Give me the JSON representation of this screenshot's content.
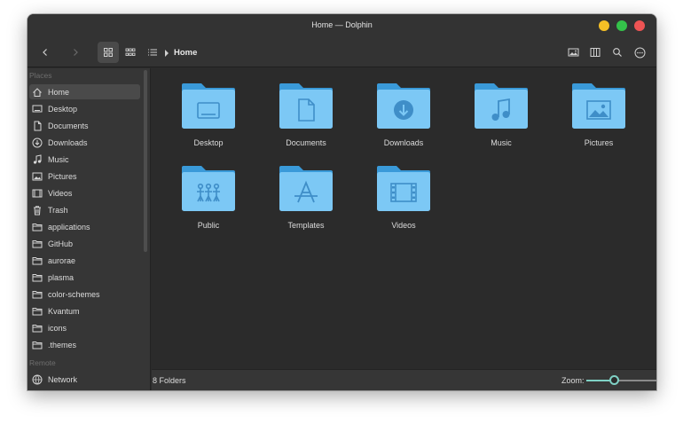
{
  "window": {
    "title": "Home — Dolphin"
  },
  "toolbar": {
    "breadcrumb": "Home"
  },
  "sidebar": {
    "places_header": "Places",
    "remote_header": "Remote",
    "places": [
      {
        "label": "Home",
        "icon": "home-icon",
        "selected": true
      },
      {
        "label": "Desktop",
        "icon": "desktop-icon"
      },
      {
        "label": "Documents",
        "icon": "document-icon"
      },
      {
        "label": "Downloads",
        "icon": "download-icon"
      },
      {
        "label": "Music",
        "icon": "music-icon"
      },
      {
        "label": "Pictures",
        "icon": "picture-icon"
      },
      {
        "label": "Videos",
        "icon": "video-icon"
      },
      {
        "label": "Trash",
        "icon": "trash-icon"
      },
      {
        "label": "applications",
        "icon": "folder-icon"
      },
      {
        "label": "GitHub",
        "icon": "folder-icon"
      },
      {
        "label": "aurorae",
        "icon": "folder-icon"
      },
      {
        "label": "plasma",
        "icon": "folder-icon"
      },
      {
        "label": "color-schemes",
        "icon": "folder-icon"
      },
      {
        "label": "Kvantum",
        "icon": "folder-icon"
      },
      {
        "label": "icons",
        "icon": "folder-icon"
      },
      {
        "label": ".themes",
        "icon": "folder-icon"
      }
    ],
    "remote": [
      {
        "label": "Network",
        "icon": "network-icon"
      }
    ]
  },
  "folders": [
    {
      "name": "Desktop",
      "emblem": "desktop-emblem"
    },
    {
      "name": "Documents",
      "emblem": "document-emblem"
    },
    {
      "name": "Downloads",
      "emblem": "download-emblem"
    },
    {
      "name": "Music",
      "emblem": "music-emblem"
    },
    {
      "name": "Pictures",
      "emblem": "picture-emblem"
    },
    {
      "name": "Public",
      "emblem": "people-emblem"
    },
    {
      "name": "Templates",
      "emblem": "template-emblem"
    },
    {
      "name": "Videos",
      "emblem": "film-emblem"
    }
  ],
  "statusbar": {
    "count": "8 Folders",
    "zoom_label": "Zoom:",
    "zoom_level": 0.4
  },
  "colors": {
    "folder_light": "#7cc8f5",
    "folder_dark": "#3a9ad9",
    "accent": "#7fd1c5"
  }
}
